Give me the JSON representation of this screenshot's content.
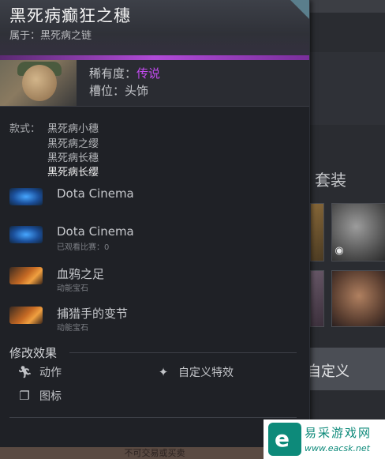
{
  "item": {
    "title": "黑死病癫狂之穗",
    "belongs_to": "属于：黑死病之链",
    "rarity_label": "稀有度：",
    "rarity_value": "传说",
    "slot_label": "槽位：",
    "slot_value": "头饰"
  },
  "styles": {
    "label": "款式：",
    "items": [
      "黑死病小穗",
      "黑死病之缨",
      "黑死病长穗",
      "黑死病长缨"
    ],
    "active_index": 3
  },
  "gems": [
    {
      "title": "Dota Cinema",
      "sub": "",
      "icon": "dota-cinema-gem-icon"
    },
    {
      "title": "Dota Cinema",
      "sub": "已观看比赛：0",
      "icon": "dota-cinema-gem-icon"
    },
    {
      "title": "血鸦之足",
      "sub": "动能宝石",
      "icon": "kinetic-gem-icon"
    },
    {
      "title": "捕猎手的变节",
      "sub": "动能宝石",
      "icon": "kinetic-gem-icon"
    }
  ],
  "modifiers": {
    "title": "修改效果",
    "items": [
      {
        "label": "动作",
        "icon": "running-figure-icon"
      },
      {
        "label": "自定义特效",
        "icon": "sparkle-wand-icon"
      },
      {
        "label": "图标",
        "icon": "stacked-squares-icon"
      }
    ]
  },
  "footer": "不可交易或买卖",
  "right_panel": {
    "set_label": "套装",
    "custom_button": "自定义"
  },
  "watermark": {
    "cn": "易采游戏网",
    "url": "www.eacsk.net"
  },
  "colors": {
    "legendary": "#c34bf0",
    "panel_bg": "#1f2126",
    "rarity_bar": "#b14ad9"
  }
}
